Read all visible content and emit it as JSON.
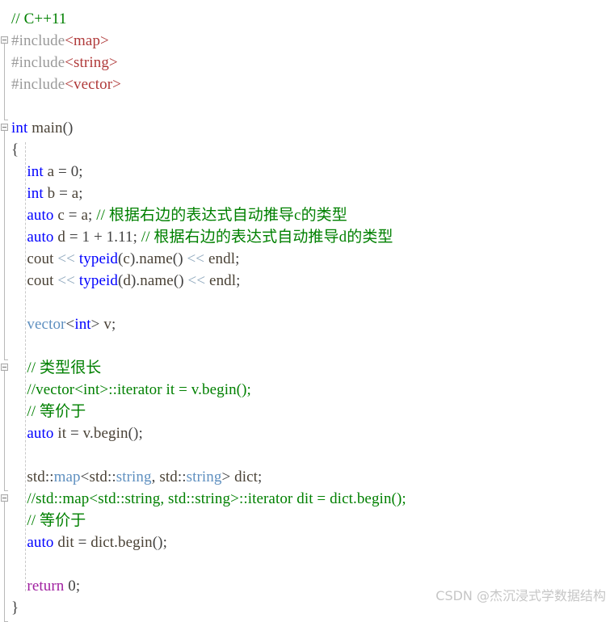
{
  "editor": {
    "language": "cpp",
    "background": "#ffffff",
    "colors": {
      "comment": "#008000",
      "keyword": "#0000ff",
      "return_keyword": "#a020a0",
      "type_name": "#5f90c0",
      "header_name": "#b03a3a",
      "preprocessor": "#9a9a9a",
      "operator": "#8fa8bd",
      "identifier": "#4a4236",
      "default_text": "#404040",
      "indent_guide": "#c9c9c9",
      "fold_marker": "#a9a9a9",
      "watermark": "#c6c6c6"
    }
  },
  "lines": [
    {
      "n": 1,
      "fold": null,
      "tokens": [
        {
          "t": "comment",
          "v": "// C++11"
        }
      ]
    },
    {
      "n": 2,
      "fold": "open",
      "tokens": [
        {
          "t": "preprocessor",
          "v": "#include"
        },
        {
          "t": "header",
          "v": "<map>"
        }
      ]
    },
    {
      "n": 3,
      "fold": null,
      "tokens": [
        {
          "t": "preprocessor",
          "v": "#include"
        },
        {
          "t": "header",
          "v": "<string>"
        }
      ]
    },
    {
      "n": 4,
      "fold": null,
      "tokens": [
        {
          "t": "preprocessor",
          "v": "#include"
        },
        {
          "t": "header",
          "v": "<vector>"
        }
      ]
    },
    {
      "n": 5,
      "fold": null,
      "tokens": []
    },
    {
      "n": 6,
      "fold": "open",
      "tokens": [
        {
          "t": "keyword",
          "v": "int"
        },
        {
          "t": "plain",
          "v": " "
        },
        {
          "t": "identifier",
          "v": "main"
        },
        {
          "t": "punct",
          "v": "()"
        }
      ]
    },
    {
      "n": 7,
      "fold": null,
      "tokens": [
        {
          "t": "brace",
          "v": "{"
        }
      ]
    },
    {
      "n": 8,
      "fold": null,
      "tokens": [
        {
          "t": "keyword",
          "v": "    int"
        },
        {
          "t": "plain",
          "v": " "
        },
        {
          "t": "identifier",
          "v": "a"
        },
        {
          "t": "punct",
          "v": " = "
        },
        {
          "t": "number",
          "v": "0"
        },
        {
          "t": "punct",
          "v": ";"
        }
      ]
    },
    {
      "n": 9,
      "fold": null,
      "tokens": [
        {
          "t": "keyword",
          "v": "    int"
        },
        {
          "t": "plain",
          "v": " "
        },
        {
          "t": "identifier",
          "v": "b"
        },
        {
          "t": "punct",
          "v": " = "
        },
        {
          "t": "identifier",
          "v": "a"
        },
        {
          "t": "punct",
          "v": ";"
        }
      ]
    },
    {
      "n": 10,
      "fold": null,
      "tokens": [
        {
          "t": "keyword",
          "v": "    auto"
        },
        {
          "t": "plain",
          "v": " "
        },
        {
          "t": "identifier",
          "v": "c"
        },
        {
          "t": "punct",
          "v": " = "
        },
        {
          "t": "identifier",
          "v": "a"
        },
        {
          "t": "punct",
          "v": ";"
        },
        {
          "t": "comment",
          "v": " // 根据右边的表达式自动推导c的类型"
        }
      ]
    },
    {
      "n": 11,
      "fold": null,
      "tokens": [
        {
          "t": "keyword",
          "v": "    auto"
        },
        {
          "t": "plain",
          "v": " "
        },
        {
          "t": "identifier",
          "v": "d"
        },
        {
          "t": "punct",
          "v": " = "
        },
        {
          "t": "number",
          "v": "1"
        },
        {
          "t": "punct",
          "v": " + "
        },
        {
          "t": "number",
          "v": "1.11"
        },
        {
          "t": "punct",
          "v": ";"
        },
        {
          "t": "comment",
          "v": " // 根据右边的表达式自动推导d的类型"
        }
      ]
    },
    {
      "n": 12,
      "fold": null,
      "tokens": [
        {
          "t": "identifier",
          "v": "    cout"
        },
        {
          "t": "operator",
          "v": " << "
        },
        {
          "t": "keyword",
          "v": "typeid"
        },
        {
          "t": "punct",
          "v": "("
        },
        {
          "t": "identifier",
          "v": "c"
        },
        {
          "t": "punct",
          "v": ")."
        },
        {
          "t": "identifier",
          "v": "name"
        },
        {
          "t": "punct",
          "v": "()"
        },
        {
          "t": "operator",
          "v": " << "
        },
        {
          "t": "identifier",
          "v": "endl"
        },
        {
          "t": "punct",
          "v": ";"
        }
      ]
    },
    {
      "n": 13,
      "fold": null,
      "tokens": [
        {
          "t": "identifier",
          "v": "    cout"
        },
        {
          "t": "operator",
          "v": " << "
        },
        {
          "t": "keyword",
          "v": "typeid"
        },
        {
          "t": "punct",
          "v": "("
        },
        {
          "t": "identifier",
          "v": "d"
        },
        {
          "t": "punct",
          "v": ")."
        },
        {
          "t": "identifier",
          "v": "name"
        },
        {
          "t": "punct",
          "v": "()"
        },
        {
          "t": "operator",
          "v": " << "
        },
        {
          "t": "identifier",
          "v": "endl"
        },
        {
          "t": "punct",
          "v": ";"
        }
      ]
    },
    {
      "n": 14,
      "fold": null,
      "tokens": []
    },
    {
      "n": 15,
      "fold": null,
      "tokens": [
        {
          "t": "type",
          "v": "    vector"
        },
        {
          "t": "punct",
          "v": "<"
        },
        {
          "t": "keyword",
          "v": "int"
        },
        {
          "t": "punct",
          "v": "> "
        },
        {
          "t": "identifier",
          "v": "v"
        },
        {
          "t": "punct",
          "v": ";"
        }
      ]
    },
    {
      "n": 16,
      "fold": null,
      "tokens": []
    },
    {
      "n": 17,
      "fold": "open",
      "tokens": [
        {
          "t": "comment",
          "v": "    // 类型很长"
        }
      ]
    },
    {
      "n": 18,
      "fold": null,
      "tokens": [
        {
          "t": "comment",
          "v": "    //vector<int>::iterator it = v.begin();"
        }
      ]
    },
    {
      "n": 19,
      "fold": null,
      "tokens": [
        {
          "t": "comment",
          "v": "    // 等价于"
        }
      ]
    },
    {
      "n": 20,
      "fold": null,
      "tokens": [
        {
          "t": "keyword",
          "v": "    auto"
        },
        {
          "t": "plain",
          "v": " "
        },
        {
          "t": "identifier",
          "v": "it"
        },
        {
          "t": "punct",
          "v": " = "
        },
        {
          "t": "identifier",
          "v": "v"
        },
        {
          "t": "punct",
          "v": "."
        },
        {
          "t": "identifier",
          "v": "begin"
        },
        {
          "t": "punct",
          "v": "();"
        }
      ]
    },
    {
      "n": 21,
      "fold": null,
      "tokens": []
    },
    {
      "n": 22,
      "fold": null,
      "tokens": [
        {
          "t": "identifier",
          "v": "    std"
        },
        {
          "t": "punct",
          "v": "::"
        },
        {
          "t": "type",
          "v": "map"
        },
        {
          "t": "punct",
          "v": "<"
        },
        {
          "t": "identifier",
          "v": "std"
        },
        {
          "t": "punct",
          "v": "::"
        },
        {
          "t": "type",
          "v": "string"
        },
        {
          "t": "punct",
          "v": ", "
        },
        {
          "t": "identifier",
          "v": "std"
        },
        {
          "t": "punct",
          "v": "::"
        },
        {
          "t": "type",
          "v": "string"
        },
        {
          "t": "punct",
          "v": "> "
        },
        {
          "t": "identifier",
          "v": "dict"
        },
        {
          "t": "punct",
          "v": ";"
        }
      ]
    },
    {
      "n": 23,
      "fold": "open",
      "tokens": [
        {
          "t": "comment",
          "v": "    //std::map<std::string, std::string>::iterator dit = dict.begin();"
        }
      ]
    },
    {
      "n": 24,
      "fold": null,
      "tokens": [
        {
          "t": "comment",
          "v": "    // 等价于"
        }
      ]
    },
    {
      "n": 25,
      "fold": null,
      "tokens": [
        {
          "t": "keyword",
          "v": "    auto"
        },
        {
          "t": "plain",
          "v": " "
        },
        {
          "t": "identifier",
          "v": "dit"
        },
        {
          "t": "punct",
          "v": " = "
        },
        {
          "t": "identifier",
          "v": "dict"
        },
        {
          "t": "punct",
          "v": "."
        },
        {
          "t": "identifier",
          "v": "begin"
        },
        {
          "t": "punct",
          "v": "();"
        }
      ]
    },
    {
      "n": 26,
      "fold": null,
      "tokens": []
    },
    {
      "n": 27,
      "fold": null,
      "tokens": [
        {
          "t": "return",
          "v": "    return"
        },
        {
          "t": "plain",
          "v": " "
        },
        {
          "t": "number",
          "v": "0"
        },
        {
          "t": "punct",
          "v": ";"
        }
      ]
    },
    {
      "n": 28,
      "fold": null,
      "tokens": [
        {
          "t": "brace",
          "v": "}"
        }
      ]
    }
  ],
  "watermark": {
    "text": "CSDN @杰沉浸式学数据结构"
  }
}
